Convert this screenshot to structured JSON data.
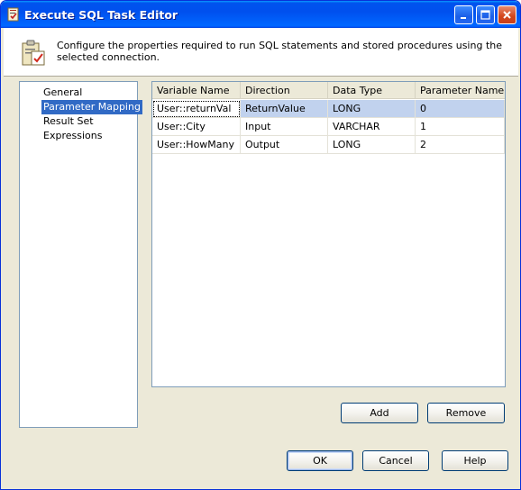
{
  "window": {
    "title": "Execute SQL Task Editor",
    "buttons": {
      "minimize_icon": "minimize-icon",
      "maximize_icon": "maximize-icon",
      "close_icon": "close-icon"
    }
  },
  "header": {
    "description": "Configure the properties required to run SQL statements and stored procedures using the selected connection.",
    "icon": "sql-task-icon"
  },
  "nav": {
    "items": [
      {
        "label": "General",
        "selected": false
      },
      {
        "label": "Parameter Mapping",
        "selected": true
      },
      {
        "label": "Result Set",
        "selected": false
      },
      {
        "label": "Expressions",
        "selected": false
      }
    ]
  },
  "grid": {
    "columns": [
      "Variable Name",
      "Direction",
      "Data Type",
      "Parameter Name"
    ],
    "rows": [
      [
        "User::returnVal",
        "ReturnValue",
        "LONG",
        "0"
      ],
      [
        "User::City",
        "Input",
        "VARCHAR",
        "1"
      ],
      [
        "User::HowMany",
        "Output",
        "LONG",
        "2"
      ]
    ],
    "selected_row": 0
  },
  "grid_buttons": {
    "add": "Add",
    "remove": "Remove"
  },
  "footer": {
    "ok": "OK",
    "cancel": "Cancel",
    "help": "Help"
  },
  "colors": {
    "title_blue": "#0053ee",
    "selection": "#316ac5",
    "face": "#ece9d8"
  }
}
